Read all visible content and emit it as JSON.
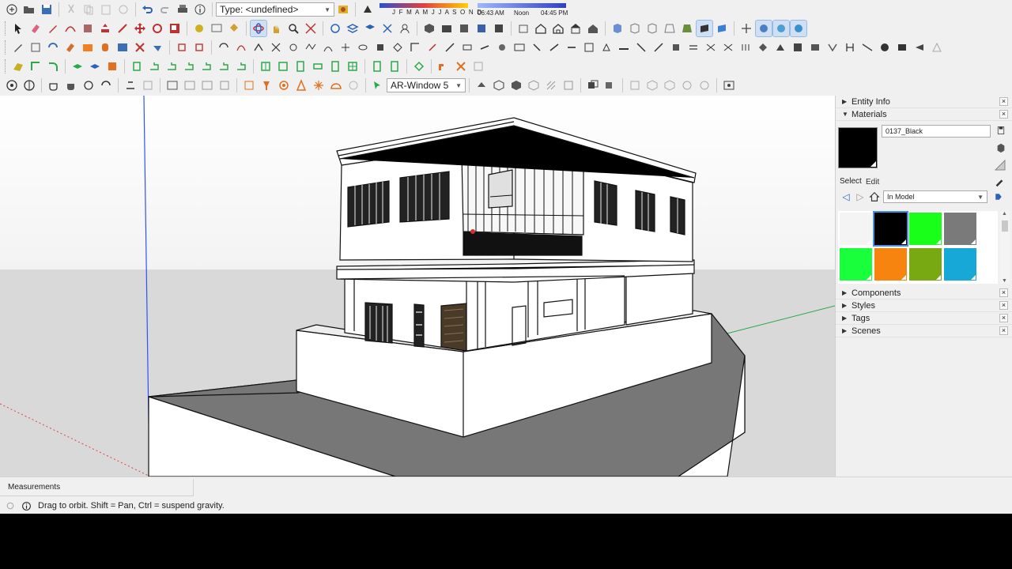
{
  "toolbar": {
    "type_dropdown": "Type: <undefined>",
    "layer_dropdown": "AR-Window 5",
    "shadow_months": "J F M A M J J A S O N D",
    "shadow_time_start": "06:43 AM",
    "shadow_time_mid": "Noon",
    "shadow_time_end": "04:45 PM"
  },
  "tray": {
    "entity_info": "Entity Info",
    "materials": "Materials",
    "material_name": "0137_Black",
    "tab_select": "Select",
    "tab_edit": "Edit",
    "library_dropdown": "In Model",
    "components": "Components",
    "styles": "Styles",
    "tags": "Tags",
    "scenes": "Scenes",
    "swatch_colors": [
      "#f4f4f4",
      "#000000",
      "#19ff19",
      "#7a7a7a",
      "#19ff3c",
      "#f7840f",
      "#79a912",
      "#18a8d8"
    ]
  },
  "status": {
    "measurements_label": "Measurements",
    "hint": "Drag to orbit. Shift = Pan, Ctrl = suspend gravity."
  },
  "colors": {
    "accent": "#cfe0f4",
    "axis_blue": "#3050ff",
    "axis_green": "#2aa84a",
    "axis_red": "#d03030"
  }
}
